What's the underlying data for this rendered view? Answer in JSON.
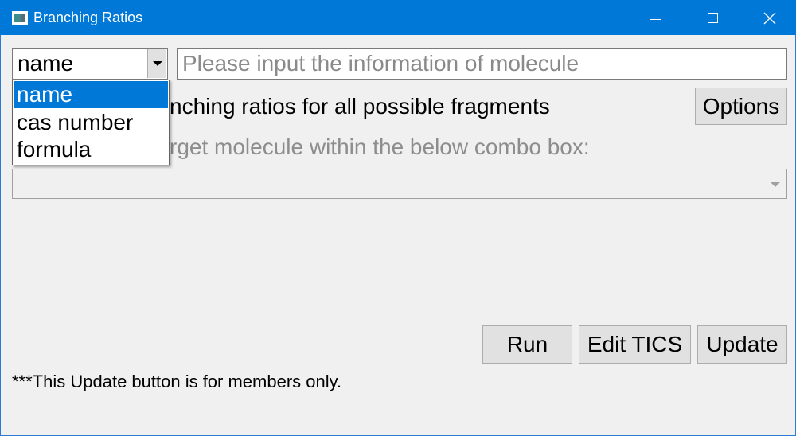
{
  "window": {
    "title": "Branching Ratios",
    "controls": {
      "minimize": "—",
      "maximize": "☐",
      "close": "✕"
    }
  },
  "colors": {
    "titlebar": "#0078d7",
    "selection": "#0078d7",
    "background": "#f0f0f0"
  },
  "search_type": {
    "selected": "name",
    "options": [
      "name",
      "cas number",
      "formula"
    ]
  },
  "molecule_input": {
    "value": "",
    "placeholder": "Please input the information of molecule"
  },
  "checkbox_label_visible": "nching ratios for all possible fragments",
  "options_button": "Options",
  "hint_visible": "rget molecule within the below combo box:",
  "molecule_combo": {
    "value": ""
  },
  "buttons": {
    "run": "Run",
    "edit_tics": "Edit TICS",
    "update": "Update"
  },
  "footnote": "***This Update button is for members only."
}
